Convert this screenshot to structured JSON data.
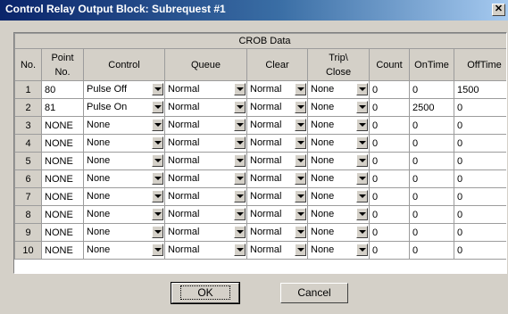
{
  "window": {
    "title": "Control Relay Output Block: Subrequest #1",
    "close_glyph": "✕"
  },
  "table": {
    "group_header": "CROB Data",
    "columns": [
      "No.",
      "Point\nNo.",
      "Control",
      "Queue",
      "Clear",
      "Trip\\\nClose",
      "Count",
      "OnTime",
      "OffTime"
    ],
    "rows": [
      {
        "no": "1",
        "point": "80",
        "control": "Pulse Off",
        "queue": "Normal",
        "clear": "Normal",
        "trip": "None",
        "count": "0",
        "on": "0",
        "off": "1500"
      },
      {
        "no": "2",
        "point": "81",
        "control": "Pulse On",
        "queue": "Normal",
        "clear": "Normal",
        "trip": "None",
        "count": "0",
        "on": "2500",
        "off": "0"
      },
      {
        "no": "3",
        "point": "NONE",
        "control": "None",
        "queue": "Normal",
        "clear": "Normal",
        "trip": "None",
        "count": "0",
        "on": "0",
        "off": "0"
      },
      {
        "no": "4",
        "point": "NONE",
        "control": "None",
        "queue": "Normal",
        "clear": "Normal",
        "trip": "None",
        "count": "0",
        "on": "0",
        "off": "0"
      },
      {
        "no": "5",
        "point": "NONE",
        "control": "None",
        "queue": "Normal",
        "clear": "Normal",
        "trip": "None",
        "count": "0",
        "on": "0",
        "off": "0"
      },
      {
        "no": "6",
        "point": "NONE",
        "control": "None",
        "queue": "Normal",
        "clear": "Normal",
        "trip": "None",
        "count": "0",
        "on": "0",
        "off": "0"
      },
      {
        "no": "7",
        "point": "NONE",
        "control": "None",
        "queue": "Normal",
        "clear": "Normal",
        "trip": "None",
        "count": "0",
        "on": "0",
        "off": "0"
      },
      {
        "no": "8",
        "point": "NONE",
        "control": "None",
        "queue": "Normal",
        "clear": "Normal",
        "trip": "None",
        "count": "0",
        "on": "0",
        "off": "0"
      },
      {
        "no": "9",
        "point": "NONE",
        "control": "None",
        "queue": "Normal",
        "clear": "Normal",
        "trip": "None",
        "count": "0",
        "on": "0",
        "off": "0"
      },
      {
        "no": "10",
        "point": "NONE",
        "control": "None",
        "queue": "Normal",
        "clear": "Normal",
        "trip": "None",
        "count": "0",
        "on": "0",
        "off": "0"
      }
    ]
  },
  "buttons": {
    "ok": "OK",
    "cancel": "Cancel"
  }
}
